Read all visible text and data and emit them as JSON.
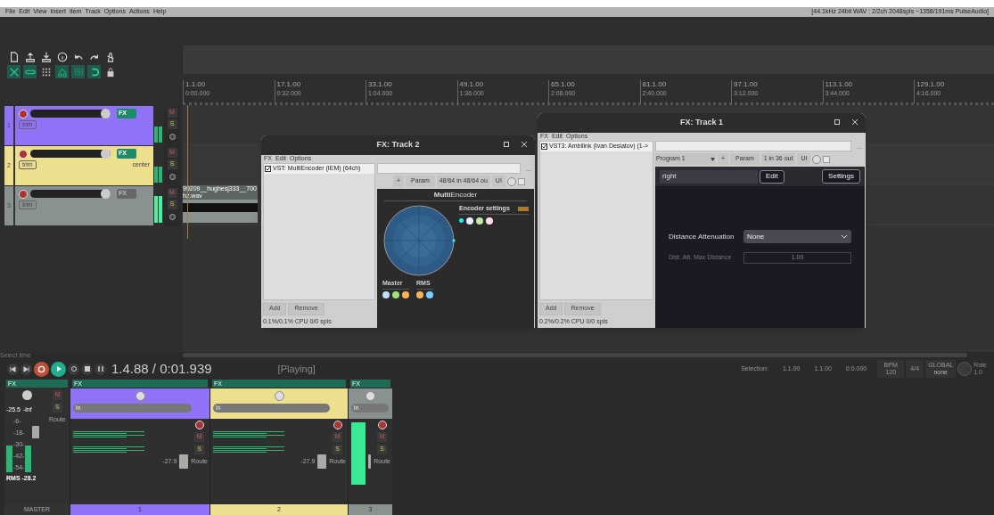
{
  "menu_bar": {
    "items": [
      "File",
      "Edit",
      "View",
      "Insert",
      "Item",
      "Track",
      "Options",
      "Actions",
      "Help"
    ],
    "status": "[44.1kHz 24bit WAV : 2/2ch 2048spls ~1358/191ms PulseAudio]"
  },
  "ruler": [
    {
      "bar": "1.1.00",
      "time": "0:00.000"
    },
    {
      "bar": "17.1.00",
      "time": "0:32.000"
    },
    {
      "bar": "33.1.00",
      "time": "1:04.000"
    },
    {
      "bar": "49.1.00",
      "time": "1:36.000"
    },
    {
      "bar": "65.1.00",
      "time": "2:08.000"
    },
    {
      "bar": "81.1.00",
      "time": "2:40.000"
    },
    {
      "bar": "97.1.00",
      "time": "3:12.000"
    },
    {
      "bar": "113.1.00",
      "time": "3:44.000"
    },
    {
      "bar": "129.1.00",
      "time": "4:16.000"
    }
  ],
  "tracks": [
    {
      "number": "1",
      "color": "#8f72f5",
      "fx_label": "FX",
      "fx_active": true,
      "trim": "trim",
      "mute_label": "M",
      "solo_label": "S"
    },
    {
      "number": "2",
      "color": "#ece08f",
      "fx_label": "FX",
      "fx_active": true,
      "trim": "trim",
      "pan": "center",
      "mute_label": "M",
      "solo_label": "S"
    },
    {
      "number": "3",
      "color": "#8a9191",
      "fx_label": "FX",
      "fx_active": false,
      "trim": "trim",
      "mute_label": "M",
      "solo_label": "S",
      "item": "99209__hughesj333__700hz.wav"
    }
  ],
  "fx_windows": [
    {
      "title": "FX: Track 2",
      "menu": [
        "FX",
        "Edit",
        "Options"
      ],
      "plugins": [
        {
          "name": "VST: MultiEncoder (IEM) (64ch)",
          "enabled": true
        }
      ],
      "more": "...",
      "add": "+",
      "param": "Param",
      "io": "48/64 in 48/64 ou",
      "ui": "UI",
      "buttons": [
        "Add",
        "Remove"
      ],
      "cpu": "0.1%/0.1% CPU 0/0 spls",
      "plugin_ui": {
        "kind": "multiencoder",
        "title": "**Multi**Encoder",
        "settings": "Encoder settings",
        "master": "Master",
        "rms": "RMS"
      }
    },
    {
      "title": "FX: Track 1",
      "menu": [
        "FX",
        "Edit",
        "Options"
      ],
      "plugins": [
        {
          "name": "VST3: Ambilink (Ivan Desiatov) (1->",
          "enabled": true
        }
      ],
      "more": "...",
      "program": "Program 1",
      "add": "+",
      "param": "Param",
      "io": "1 in 36 out",
      "ui": "UI",
      "buttons": [
        "Add",
        "Remove"
      ],
      "cpu": "0.2%/0.2% CPU 0/0 spls",
      "plugin_ui": {
        "kind": "ambilink",
        "name": "right",
        "edit": "Edit",
        "settings": "Settings",
        "rows": [
          {
            "kind": "dropdown",
            "label": "Distance Attenuation",
            "value": "None",
            "disabled": false
          },
          {
            "kind": "number",
            "label": "Dist. Att. Max Distance",
            "value": "1.00",
            "disabled": true
          }
        ]
      }
    }
  ],
  "transport": {
    "hint": "Select time",
    "playing": true,
    "position": "1.4.88 / 0:01.939",
    "state": "[Playing]",
    "selection": {
      "label": "Selection:",
      "start": "1.1.00",
      "end": "1.1.00",
      "length": "0:0.000"
    },
    "bpm_label": "BPM",
    "bpm": "120",
    "signature": "4/4",
    "global": "GLOBAL",
    "automation": "none",
    "rate_label": "Rate",
    "rate": "1.0"
  },
  "mixer": {
    "master": {
      "label": "MASTER",
      "fx_label": "FX",
      "mute_label": "M",
      "solo_label": "S",
      "peak": "-25.5",
      "peak_hold": "-inf",
      "rms": "RMS -28.2",
      "route": "Route",
      "scale": [
        "-6-",
        "-18-",
        "-30-",
        "-42-",
        "-54-"
      ]
    },
    "channels": [
      {
        "number": "1",
        "color": "#8f72f5",
        "fx_label": "FX",
        "input": "in",
        "mute_label": "M",
        "solo_label": "S",
        "volume": "-27.9",
        "route": "Route"
      },
      {
        "number": "2",
        "color": "#ece08f",
        "fx_label": "FX",
        "input": "in",
        "mute_label": "M",
        "solo_label": "S",
        "volume": "-27.9",
        "route": "Route"
      },
      {
        "number": "3",
        "color": "#8a9191",
        "fx_label": "FX",
        "input": "in",
        "mute_label": "M",
        "solo_label": "S",
        "route": "Route"
      }
    ]
  }
}
